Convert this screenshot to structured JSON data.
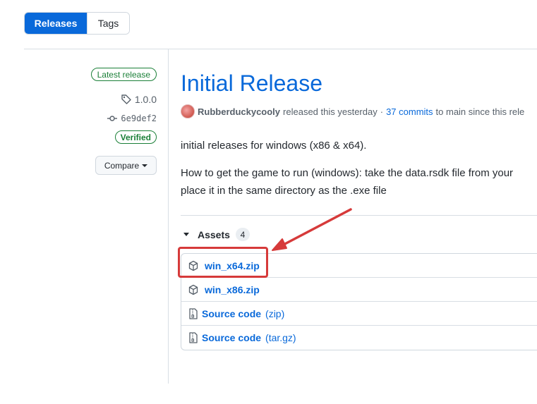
{
  "tabs": [
    {
      "label": "Releases",
      "active": true
    },
    {
      "label": "Tags",
      "active": false
    }
  ],
  "sidebar": {
    "latest_badge": "Latest release",
    "tag": "1.0.0",
    "commit": "6e9def2",
    "verified": "Verified",
    "compare_label": "Compare"
  },
  "release": {
    "title": "Initial Release",
    "author": "Rubberduckycooly",
    "byline_text": "released this yesterday",
    "separator": "·",
    "commits_link": "37 commits",
    "after_commits": "to main since this rele",
    "paragraph1": "initial releases for windows (x86 & x64).",
    "paragraph2_line1": "How to get the game to run (windows): take the data.rsdk file from your",
    "paragraph2_line2": "place it in the same directory as the .exe file"
  },
  "assets": {
    "label": "Assets",
    "count": "4",
    "items": [
      {
        "name": "win_x64.zip",
        "ext": "",
        "icon": "package-icon"
      },
      {
        "name": "win_x86.zip",
        "ext": "",
        "icon": "package-icon"
      },
      {
        "name": "Source code",
        "ext": "(zip)",
        "icon": "file-zip-icon"
      },
      {
        "name": "Source code",
        "ext": "(tar.gz)",
        "icon": "file-zip-icon"
      }
    ]
  },
  "colors": {
    "accent": "#0969da",
    "success": "#1a7f37",
    "annotation": "#d63a3a"
  }
}
